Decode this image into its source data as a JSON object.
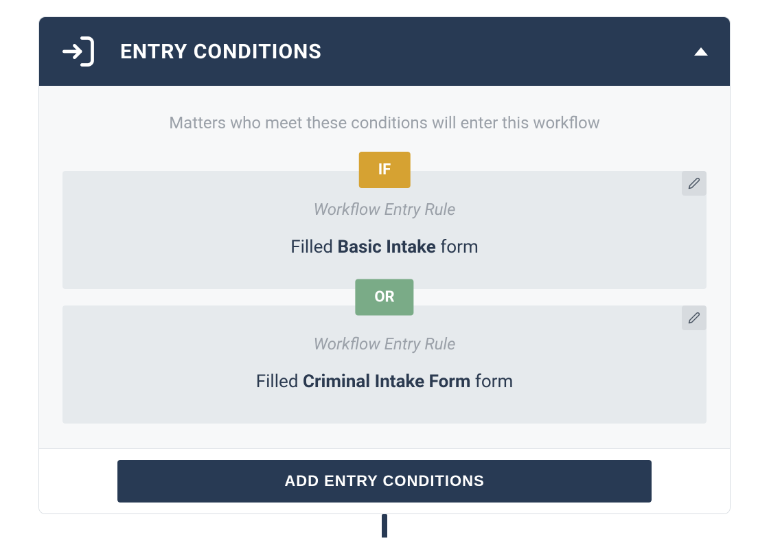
{
  "header": {
    "title": "ENTRY CONDITIONS",
    "icon": "entry-icon"
  },
  "body": {
    "description": "Matters who meet these conditions will enter this workflow",
    "if_label": "IF",
    "or_label": "OR",
    "rules": [
      {
        "title": "Workflow Entry Rule",
        "prefix": "Filled ",
        "bold": "Basic Intake",
        "suffix": " form"
      },
      {
        "title": "Workflow Entry Rule",
        "prefix": "Filled ",
        "bold": "Criminal Intake Form",
        "suffix": " form"
      }
    ]
  },
  "footer": {
    "add_button": "ADD ENTRY CONDITIONS"
  }
}
